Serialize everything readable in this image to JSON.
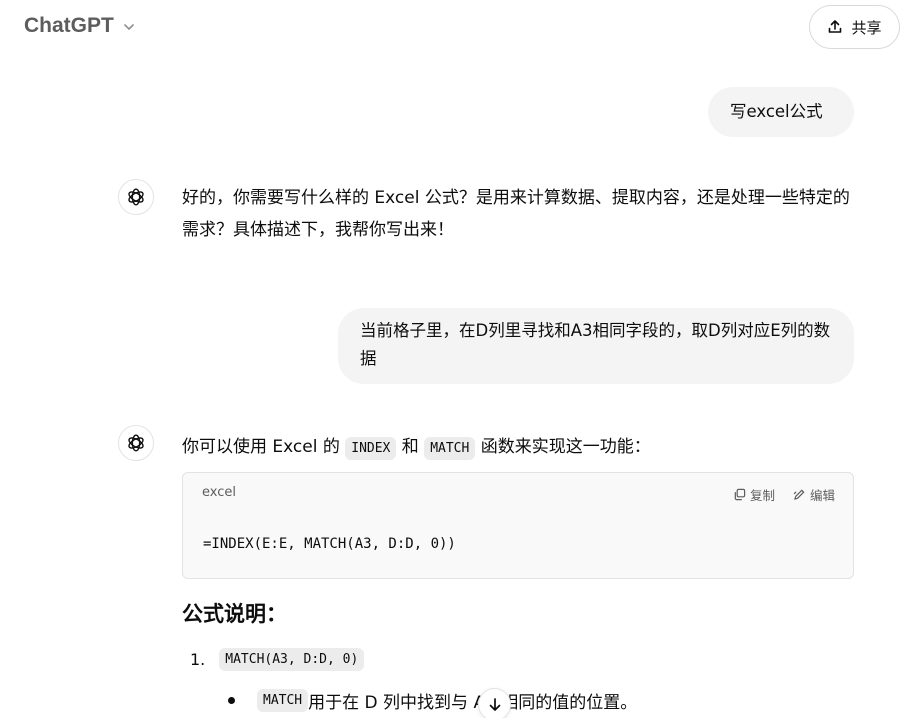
{
  "header": {
    "title": "ChatGPT",
    "share_label": "共享"
  },
  "conversation": {
    "user_1": "写excel公式",
    "assistant_1": "好的，你需要写什么样的 Excel 公式？是用来计算数据、提取内容，还是处理一些特定的需求？具体描述下，我帮你写出来！",
    "user_2": "当前格子里，在D列里寻找和A3相同字段的，取D列对应E列的数据",
    "assistant_2": {
      "intro_prefix": "你可以使用 Excel 的 ",
      "func1": "INDEX",
      "mid": " 和 ",
      "func2": "MATCH",
      "intro_suffix": " 函数来实现这一功能："
    },
    "code_block": {
      "language": "excel",
      "copy_label": "复制",
      "edit_label": "编辑",
      "code": "=INDEX(E:E, MATCH(A3, D:D, 0))"
    },
    "heading": "公式说明：",
    "list_item_1": {
      "number": "1.",
      "code": "MATCH(A3, D:D, 0)"
    },
    "bullet_1": {
      "code": "MATCH",
      "text": " 用于在 D 列中找到与 A3 相同的值的位置。"
    }
  },
  "icons": {
    "chevron": "chevron-down-icon",
    "share": "share-icon",
    "avatar": "openai-logo-icon",
    "copy": "copy-icon",
    "edit": "edit-icon",
    "scroll": "arrow-down-icon"
  }
}
